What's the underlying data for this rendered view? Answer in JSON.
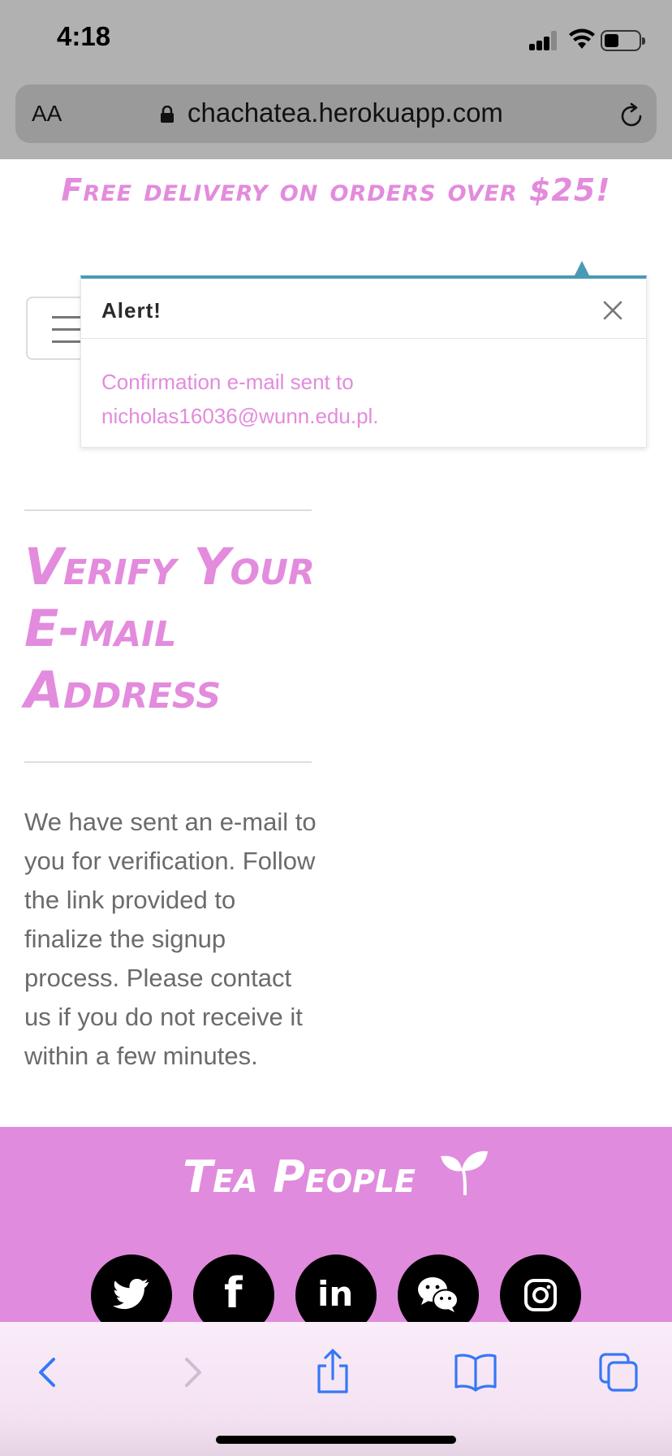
{
  "status_bar": {
    "time": "4:18",
    "icons": [
      "signal-icon",
      "wifi-icon",
      "battery-icon"
    ]
  },
  "browser": {
    "text_size_label": "AA",
    "url": "chachatea.herokuapp.com"
  },
  "promo": {
    "text": "Free delivery on orders over $25!"
  },
  "alert": {
    "title": "Alert!",
    "message": "Confirmation e-mail sent to nicholas16036@wunn.edu.pl."
  },
  "page": {
    "heading": "Verify Your E-mail Address",
    "body": "We have sent an e-mail to you for verification. Follow the link provided to finalize the signup process. Please contact us if you do not receive it within a few minutes."
  },
  "footer": {
    "brand": "Tea People",
    "socials": [
      "twitter-icon",
      "facebook-icon",
      "linkedin-icon",
      "wechat-icon",
      "instagram-icon"
    ]
  },
  "toolbar": {
    "items": [
      "back-icon",
      "forward-icon",
      "share-icon",
      "bookmarks-icon",
      "tabs-icon"
    ]
  },
  "colors": {
    "accent_pink": "#e38bdd",
    "alert_border": "#4a9ab6",
    "browser_chrome": "#b1b1b1",
    "ios_blue": "#3478f6"
  }
}
